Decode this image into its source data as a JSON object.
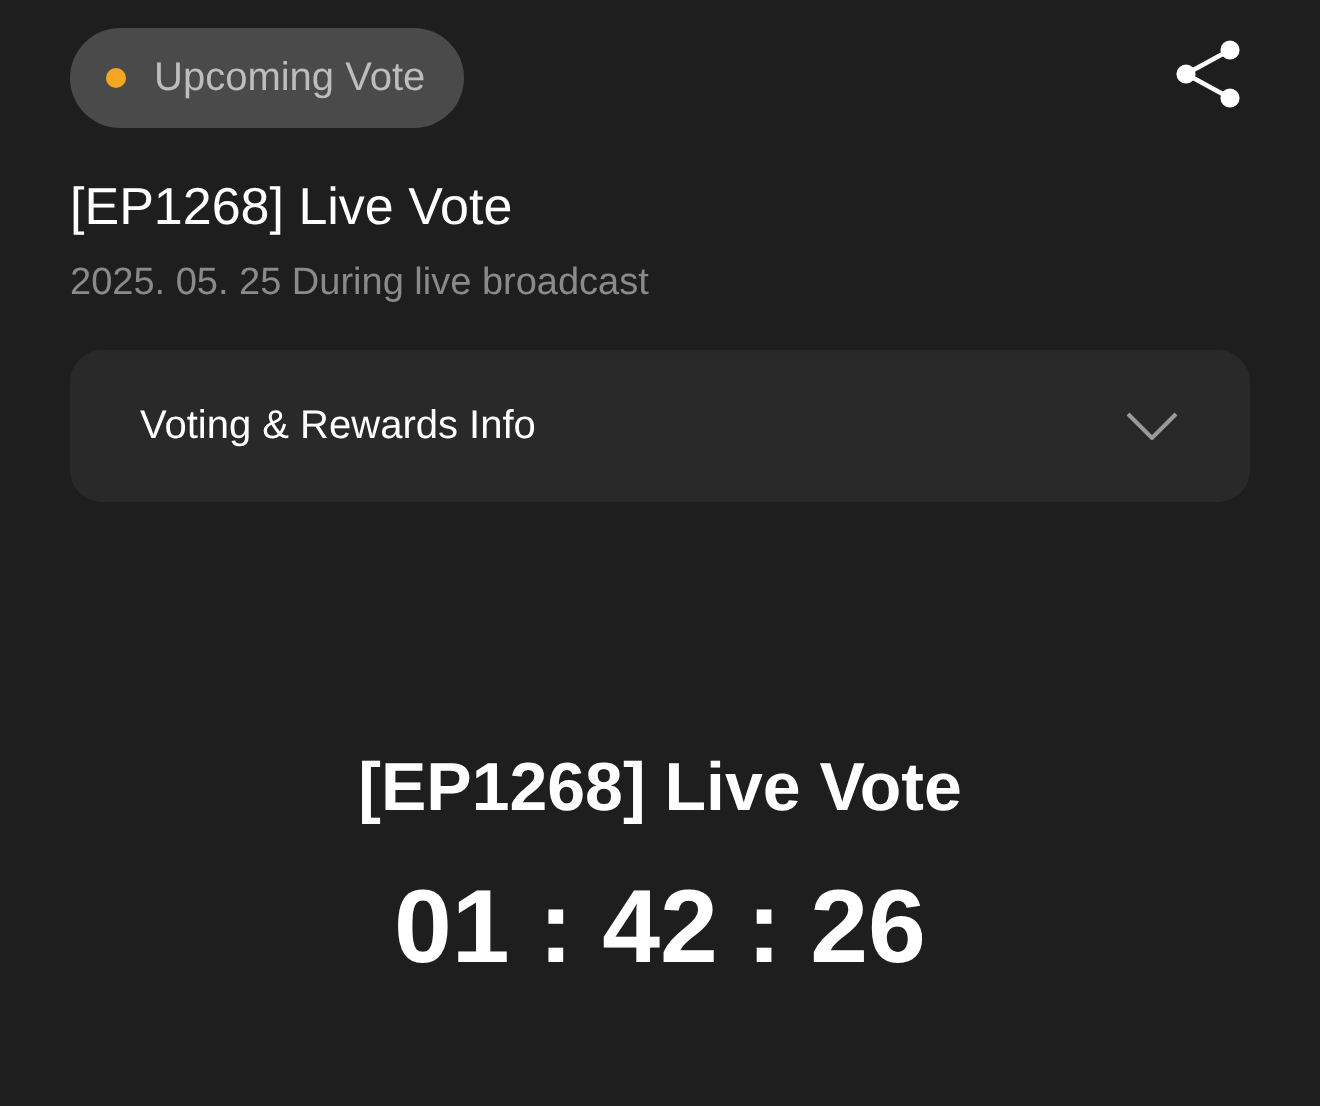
{
  "status_badge": {
    "label": "Upcoming Vote",
    "color": "#f5a623"
  },
  "title": "[EP1268] Live Vote",
  "date": "2025. 05. 25 During live broadcast",
  "accordion": {
    "label": "Voting & Rewards Info",
    "expanded": false
  },
  "countdown": {
    "title": "[EP1268] Live Vote",
    "time": "01 : 42 : 26"
  }
}
